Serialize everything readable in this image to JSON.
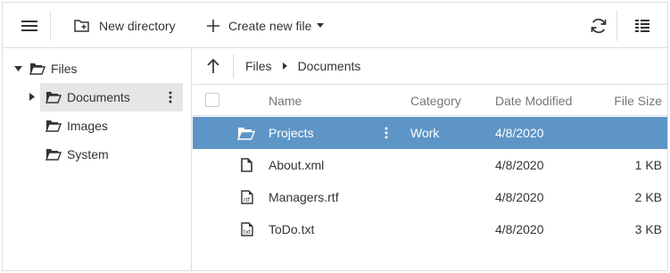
{
  "toolbar": {
    "menu_icon": "hamburger-menu-icon",
    "new_directory_label": "New directory",
    "create_new_file_label": "Create new file",
    "refresh_icon": "refresh-icon",
    "view_icon": "details-view-icon"
  },
  "tree": {
    "root": {
      "label": "Files",
      "expanded": true
    },
    "items": [
      {
        "label": "Documents",
        "selected": true,
        "has_children": true
      },
      {
        "label": "Images",
        "selected": false,
        "has_children": false
      },
      {
        "label": "System",
        "selected": false,
        "has_children": false
      }
    ]
  },
  "breadcrumb": {
    "items": [
      "Files",
      "Documents"
    ]
  },
  "grid": {
    "columns": [
      "Name",
      "Category",
      "Date Modified",
      "File Size"
    ],
    "rows": [
      {
        "icon": "folder-icon",
        "name": "Projects",
        "category": "Work",
        "date": "4/8/2020",
        "size": "",
        "selected": true
      },
      {
        "icon": "file-icon",
        "name": "About.xml",
        "category": "",
        "date": "4/8/2020",
        "size": "1 KB",
        "selected": false
      },
      {
        "icon": "rtf-file-icon",
        "name": "Managers.rtf",
        "category": "",
        "date": "4/8/2020",
        "size": "2 KB",
        "selected": false
      },
      {
        "icon": "txt-file-icon",
        "name": "ToDo.txt",
        "category": "",
        "date": "4/8/2020",
        "size": "3 KB",
        "selected": false
      }
    ]
  },
  "colors": {
    "selection": "#5e95c7",
    "tree_selection": "#e6e6e6",
    "border": "#dddddd",
    "header_text": "#777777"
  }
}
